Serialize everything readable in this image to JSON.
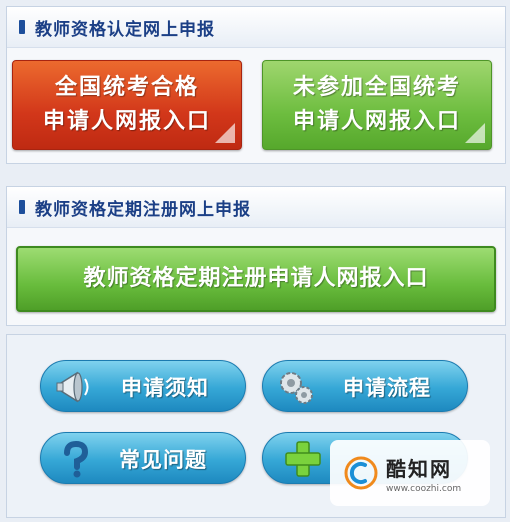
{
  "section_online_apply": {
    "title": "教师资格认定网上申报",
    "btn_exam_passed": {
      "line1": "全国统考合格",
      "line2": "申请人网报入口"
    },
    "btn_not_exam": {
      "line1": "未参加全国统考",
      "line2": "申请人网报入口"
    }
  },
  "section_registration": {
    "title": "教师资格定期注册网上申报",
    "btn_registration": "教师资格定期注册申请人网报入口"
  },
  "quick_links": [
    {
      "label": "申请须知",
      "icon": "megaphone-icon"
    },
    {
      "label": "申请流程",
      "icon": "gears-icon"
    },
    {
      "label": "常见问题",
      "icon": "question-icon"
    },
    {
      "label": "",
      "icon": "plus-icon"
    }
  ],
  "watermark": {
    "name": "酷知网",
    "url": "www.coozhi.com"
  },
  "colors": {
    "header_text": "#1b3f86",
    "red_button": "#d2371a",
    "green_button": "#6dbd3f",
    "blue_pill": "#35a7d6"
  }
}
